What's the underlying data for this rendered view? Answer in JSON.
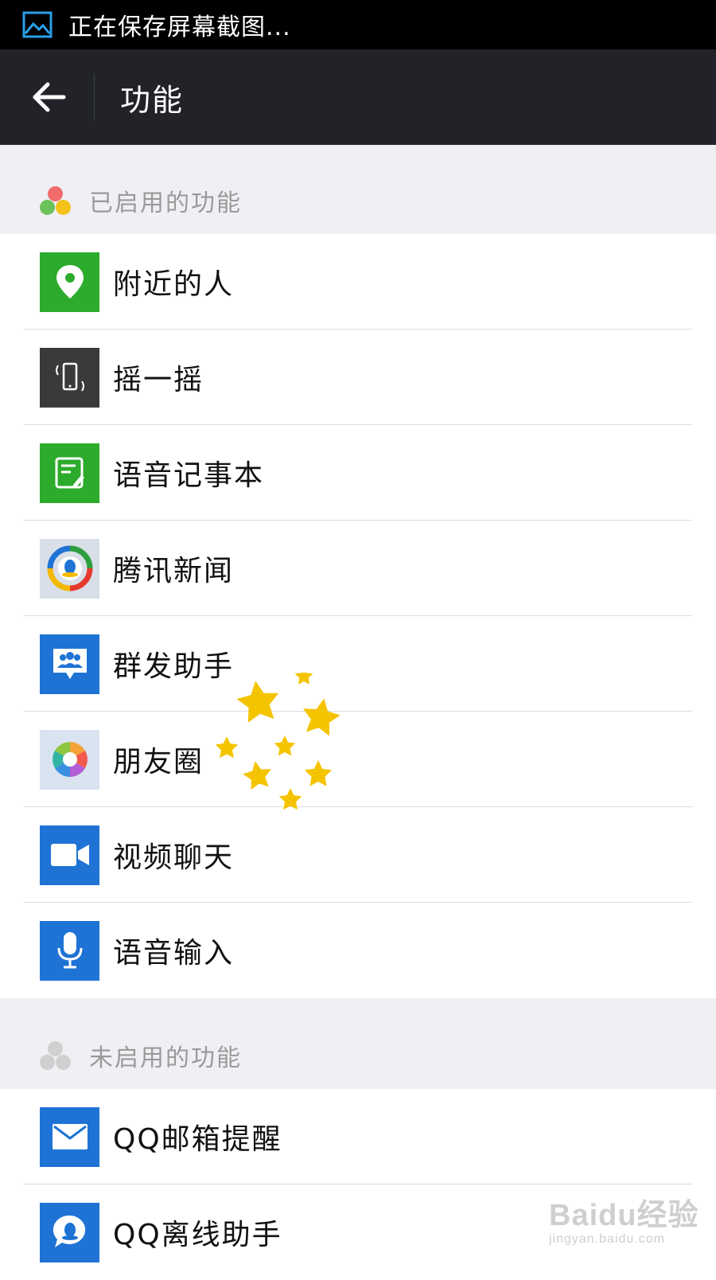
{
  "status_bar": {
    "text": "正在保存屏幕截图..."
  },
  "action_bar": {
    "title": "功能",
    "back_icon": "arrow-left-icon"
  },
  "enabled_section": {
    "title": "已启用的功能",
    "items": [
      {
        "label": "附近的人",
        "icon": "location-pin-icon",
        "color": "#2dab2c"
      },
      {
        "label": "摇一摇",
        "icon": "shake-phone-icon",
        "color": "#3a3a3c"
      },
      {
        "label": "语音记事本",
        "icon": "voice-notepad-icon",
        "color": "#2dab2c"
      },
      {
        "label": "腾讯新闻",
        "icon": "tencent-news-icon",
        "color": "#d9dfe8"
      },
      {
        "label": "群发助手",
        "icon": "broadcast-assistant-icon",
        "color": "#1e73d4"
      },
      {
        "label": "朋友圈",
        "icon": "moments-aperture-icon",
        "color": "#d9e4f0"
      },
      {
        "label": "视频聊天",
        "icon": "video-camera-icon",
        "color": "#1e73d4"
      },
      {
        "label": "语音输入",
        "icon": "microphone-icon",
        "color": "#1e73d4"
      }
    ]
  },
  "disabled_section": {
    "title": "未启用的功能",
    "items": [
      {
        "label": "QQ邮箱提醒",
        "icon": "mail-icon",
        "color": "#1e73d4"
      },
      {
        "label": "QQ离线助手",
        "icon": "qq-offline-icon",
        "color": "#1e73d4"
      }
    ]
  },
  "watermark": {
    "line1": "Baidu经验",
    "line2": "jingyan.baidu.com"
  },
  "colors": {
    "accent_green": "#2dab2c",
    "accent_blue": "#1e73d4",
    "actionbar": "#212328",
    "star": "#f5c400"
  }
}
